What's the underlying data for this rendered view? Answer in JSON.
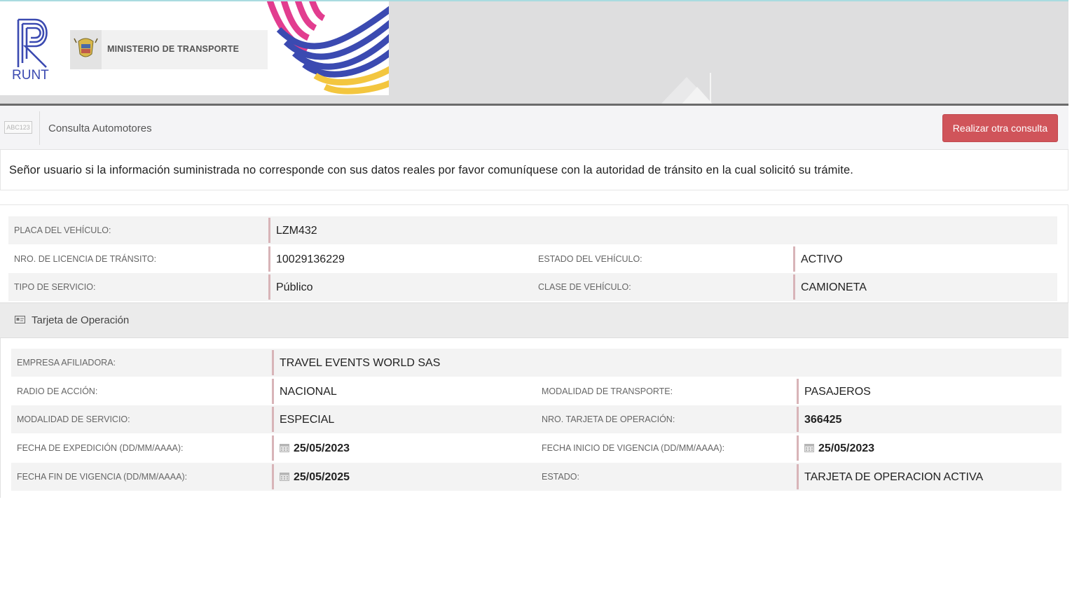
{
  "banner": {
    "logo_text": "RUNT",
    "ministry_text": "MINISTERIO DE TRANSPORTE"
  },
  "header": {
    "icon_text": "ABC123",
    "title": "Consulta Automotores",
    "action_button": "Realizar otra consulta"
  },
  "notice": "Señor usuario si la información suministrada no corresponde con sus datos reales por favor comuníquese con la autoridad de tránsito en la cual solicitó su trámite.",
  "vehicle": {
    "plate_label": "PLACA DEL VEHÍCULO:",
    "plate": "LZM432",
    "license_label": "NRO. DE LICENCIA DE TRÁNSITO:",
    "license": "10029136229",
    "status_label": "ESTADO DEL VEHÍCULO:",
    "status": "ACTIVO",
    "service_label": "TIPO DE SERVICIO:",
    "service": "Público",
    "class_label": "CLASE DE VEHÍCULO:",
    "class": "CAMIONETA"
  },
  "operation": {
    "title": "Tarjeta de Operación",
    "company_label": "EMPRESA AFILIADORA:",
    "company": "TRAVEL EVENTS WORLD SAS",
    "radius_label": "RADIO DE ACCIÓN:",
    "radius": "NACIONAL",
    "transport_mode_label": "MODALIDAD DE TRANSPORTE:",
    "transport_mode": "PASAJEROS",
    "service_mode_label": "MODALIDAD DE SERVICIO:",
    "service_mode": "ESPECIAL",
    "card_number_label": "NRO. TARJETA DE OPERACIÓN:",
    "card_number": "366425",
    "issue_date_label": "FECHA DE EXPEDICIÓN (DD/MM/AAAA):",
    "issue_date": "25/05/2023",
    "start_date_label": "FECHA INICIO DE VIGENCIA (DD/MM/AAAA):",
    "start_date": "25/05/2023",
    "end_date_label": "FECHA FIN DE VIGENCIA (DD/MM/AAAA):",
    "end_date": "25/05/2025",
    "state_label": "ESTADO:",
    "state": "TARJETA DE OPERACION ACTIVA"
  },
  "colors": {
    "brand_blue": "#3b4ab1",
    "button_red": "#d0545a",
    "value_border": "#d8b4b8"
  },
  "icons": [
    "runt-logo-icon",
    "colombia-shield-icon",
    "abc123-icon",
    "id-card-icon",
    "calendar-icon"
  ]
}
